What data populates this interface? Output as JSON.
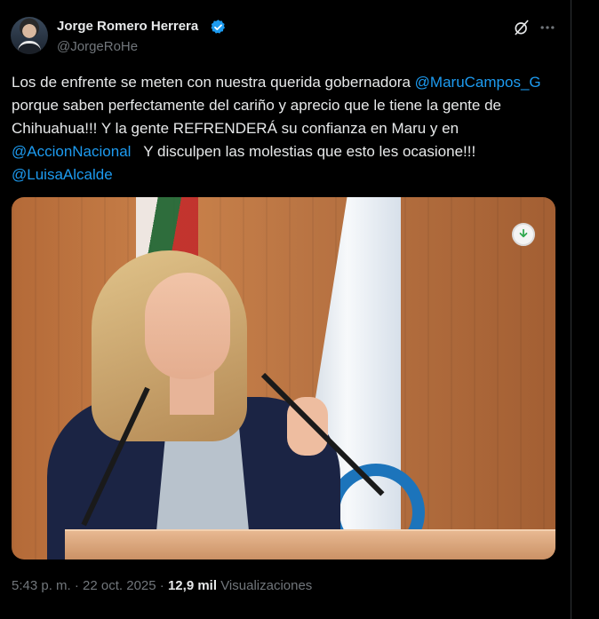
{
  "author": {
    "display_name": "Jorge Romero Herrera",
    "handle": "@JorgeRoHe",
    "verified": true
  },
  "tweet": {
    "segments": [
      {
        "text": "Los de enfrente se meten con nuestra querida gobernadora ",
        "type": "text"
      },
      {
        "text": "@MaruCampos_G",
        "type": "mention"
      },
      {
        "text": " porque saben perfectamente del cariño y aprecio que le tiene la gente de Chihuahua!!! Y la gente REFRENDERÁ su confianza en Maru y en ",
        "type": "text"
      },
      {
        "text": "@AccionNacional",
        "type": "mention"
      },
      {
        "text": "   Y disculpen las molestias que esto les ocasione!!! ",
        "type": "text"
      },
      {
        "text": "@LuisaAlcalde",
        "type": "mention"
      }
    ]
  },
  "meta": {
    "time": "5:43 p. m.",
    "separator": "·",
    "date": "22 oct. 2025",
    "views_count": "12,9 mil",
    "views_label": "Visualizaciones"
  },
  "icons": {
    "verified": "verified-badge-icon",
    "grok": "grok-icon",
    "more": "more-horizontal-icon",
    "download": "download-icon"
  },
  "colors": {
    "background": "#000000",
    "text": "#e7e9ea",
    "secondary": "#71767b",
    "accent": "#1d9bf0"
  }
}
